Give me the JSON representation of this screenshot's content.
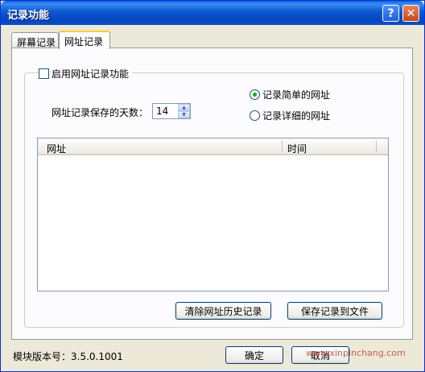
{
  "window": {
    "title": "记录功能",
    "help_glyph": "?",
    "close_glyph": "✕"
  },
  "tabs": [
    {
      "label": "屏幕记录",
      "active": false
    },
    {
      "label": "网址记录",
      "active": true
    }
  ],
  "enable": {
    "label": "启用网址记录功能",
    "checked": false
  },
  "days": {
    "label": "网址记录保存的天数：",
    "value": "14"
  },
  "mode": [
    {
      "label": "记录简单的网址",
      "checked": true
    },
    {
      "label": "记录详细的网址",
      "checked": false
    }
  ],
  "list": {
    "columns": [
      "网址",
      "时间"
    ]
  },
  "buttons": {
    "clear": "清除网址历史记录",
    "save": "保存记录到文件",
    "ok": "确定",
    "cancel": "取消"
  },
  "footer": {
    "version": "模块版本号：3.5.0.1001"
  },
  "watermark": "www.xinpinchang.com"
}
